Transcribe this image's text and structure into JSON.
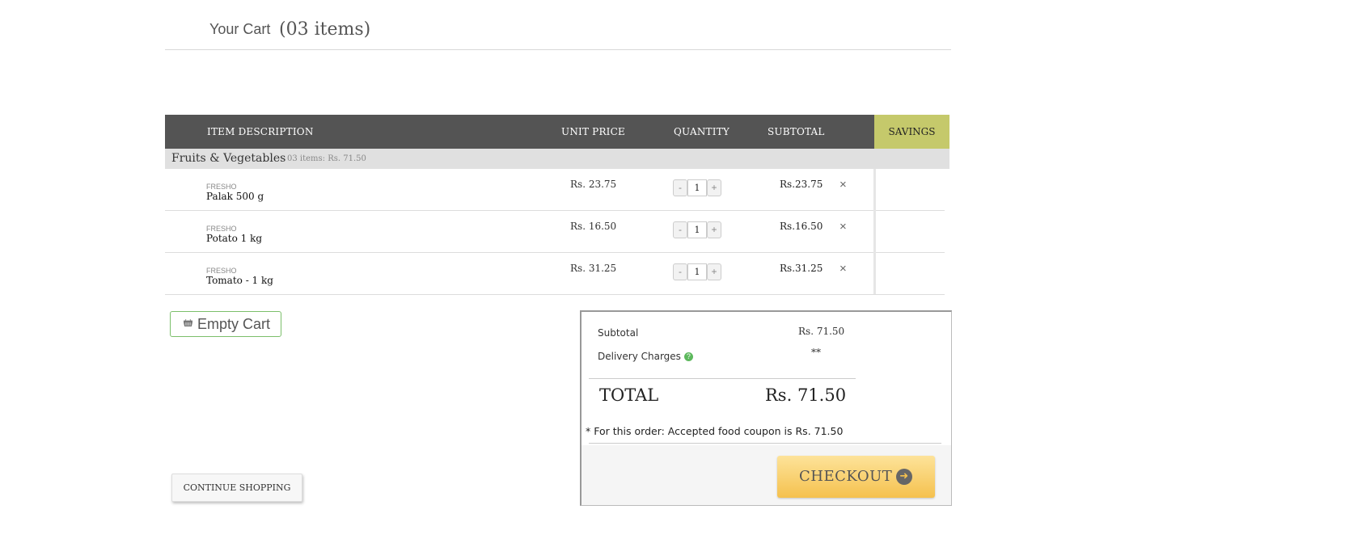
{
  "header": {
    "title": "Your Cart",
    "count": "(03 items)"
  },
  "table": {
    "columns": {
      "item_description": "ITEM DESCRIPTION",
      "unit_price": "UNIT PRICE",
      "quantity": "QUANTITY",
      "subtotal": "SUBTOTAL",
      "savings": "SAVINGS"
    },
    "category": {
      "name": "Fruits & Vegetables",
      "meta": "03 items: Rs.    71.50"
    },
    "rows": [
      {
        "brand": "FRESHO",
        "name": "Palak 500 g",
        "unit_price": "Rs. 23.75",
        "qty": "1",
        "subtotal": "Rs.23.75"
      },
      {
        "brand": "FRESHO",
        "name": "Potato 1 kg",
        "unit_price": "Rs. 16.50",
        "qty": "1",
        "subtotal": "Rs.16.50"
      },
      {
        "brand": "FRESHO",
        "name": "Tomato -    1 kg",
        "unit_price": "Rs. 31.25",
        "qty": "1",
        "subtotal": "Rs.31.25"
      }
    ],
    "minus": "-",
    "plus": "+",
    "remove": "×"
  },
  "actions": {
    "empty_cart": "Empty Cart",
    "continue_shopping": "CONTINUE SHOPPING"
  },
  "summary": {
    "subtotal_label": "Subtotal",
    "subtotal_value": "Rs. 71.50",
    "delivery_label": "Delivery Charges",
    "delivery_help": "?",
    "delivery_value": "**",
    "total_label": "TOTAL",
    "total_value": "Rs. 71.50",
    "coupon_note": "* For this order: Accepted food coupon is Rs. 71.50",
    "checkout_label": "CHECKOUT",
    "checkout_arrow": "➜"
  },
  "colors": {
    "header_bg": "#545454",
    "savings_bg": "#c5c96b",
    "checkout_bg": "#f5c14e",
    "empty_border": "#7bbf6a"
  }
}
